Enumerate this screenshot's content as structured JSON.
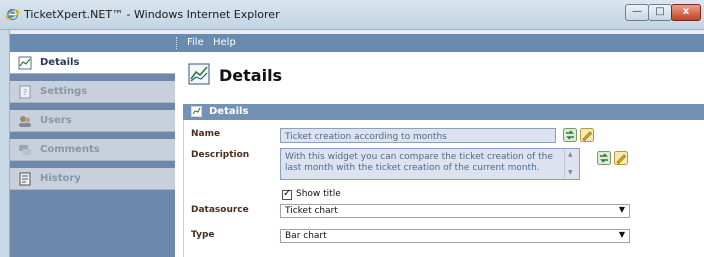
{
  "window": {
    "title": "TicketXpert.NET™ - Windows Internet Explorer",
    "minimize_glyph": "—",
    "maximize_glyph": "□",
    "close_glyph": "x"
  },
  "menu": {
    "file": "File",
    "help": "Help"
  },
  "sidebar": {
    "items": [
      {
        "label": "Details",
        "icon": "chart-icon",
        "active": true
      },
      {
        "label": "Settings",
        "icon": "settings-icon",
        "active": false
      },
      {
        "label": "Users",
        "icon": "users-icon",
        "active": false
      },
      {
        "label": "Comments",
        "icon": "comments-icon",
        "active": false
      },
      {
        "label": "History",
        "icon": "history-icon",
        "active": false
      }
    ]
  },
  "main": {
    "page_title": "Details",
    "panel_title": "Details",
    "fields": {
      "name": {
        "label": "Name",
        "value": "Ticket creation according to months"
      },
      "description": {
        "label": "Description",
        "value": "With this widget you can compare the ticket creation of the last month with the ticket creation of the current month."
      },
      "show_title": {
        "label": "Show title",
        "checked": true,
        "check_glyph": "✓"
      },
      "datasource": {
        "label": "Datasource",
        "value": "Ticket chart"
      },
      "type": {
        "label": "Type",
        "value": "Bar chart"
      }
    },
    "scroll_up_glyph": "▲",
    "scroll_down_glyph": "▼",
    "select_arrow_glyph": "▼"
  },
  "colors": {
    "menubar": "#6a8bb0",
    "sidebar": "#6e88ab",
    "panel_header": "#7591b6",
    "label_brown": "#4a2e1e"
  }
}
